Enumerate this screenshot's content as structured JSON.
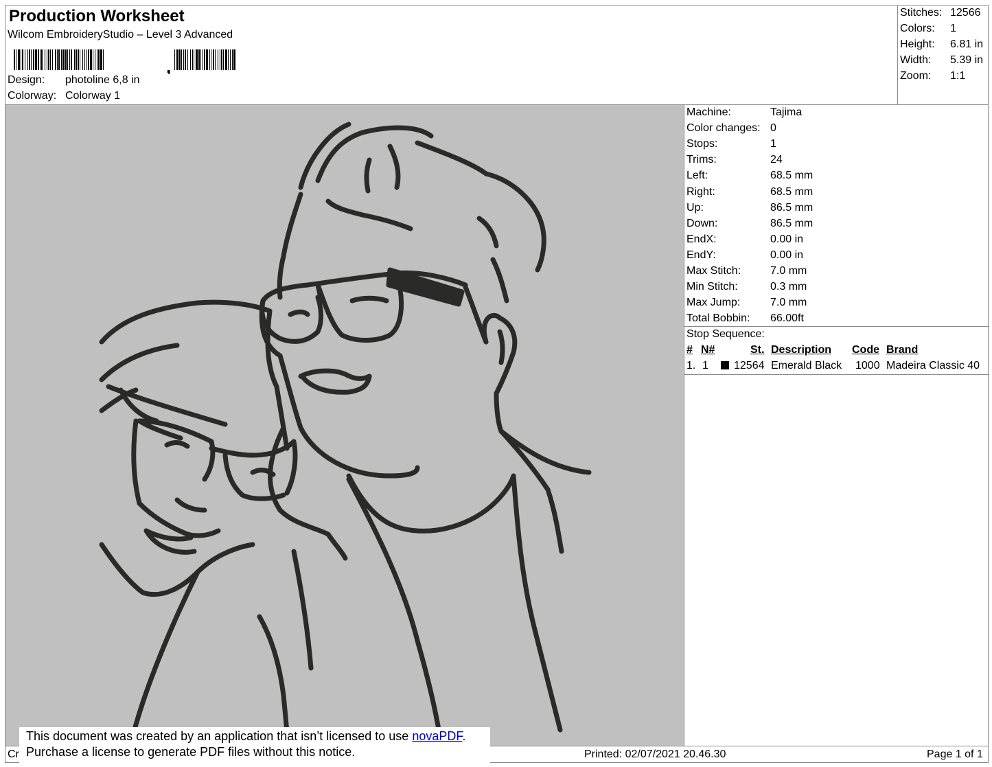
{
  "header": {
    "title": "Production Worksheet",
    "software": "Wilcom EmbroideryStudio – Level 3 Advanced",
    "design_label": "Design:",
    "design_value": "photoline 6,8 in",
    "colorway_label": "Colorway:",
    "colorway_value": "Colorway 1"
  },
  "stats": [
    {
      "label": "Stitches:",
      "value": "12566"
    },
    {
      "label": "Colors:",
      "value": "1"
    },
    {
      "label": "Height:",
      "value": "6.81 in"
    },
    {
      "label": "Width:",
      "value": "5.39 in"
    },
    {
      "label": "Zoom:",
      "value": "1:1"
    }
  ],
  "machine_details": [
    {
      "label": "Machine:",
      "value": "Tajima"
    },
    {
      "label": "Color changes:",
      "value": "0"
    },
    {
      "label": "Stops:",
      "value": "1"
    },
    {
      "label": "Trims:",
      "value": "24"
    },
    {
      "label": "Left:",
      "value": "68.5 mm"
    },
    {
      "label": "Right:",
      "value": "68.5 mm"
    },
    {
      "label": "Up:",
      "value": "86.5 mm"
    },
    {
      "label": "Down:",
      "value": "86.5 mm"
    },
    {
      "label": "EndX:",
      "value": "0.00 in"
    },
    {
      "label": "EndY:",
      "value": "0.00 in"
    },
    {
      "label": "Max Stitch:",
      "value": "7.0 mm"
    },
    {
      "label": "Min Stitch:",
      "value": "0.3 mm"
    },
    {
      "label": "Max Jump:",
      "value": "7.0 mm"
    },
    {
      "label": "Total Bobbin:",
      "value": "66.00ft"
    }
  ],
  "stop_sequence": {
    "title": "Stop Sequence:",
    "columns": [
      "#",
      "N#",
      "St.",
      "Description",
      "Code",
      "Brand"
    ],
    "rows": [
      {
        "index": "1.",
        "n": "1",
        "swatch_color": "#000000",
        "stitches": "12564",
        "description": "Emerald Black",
        "code": "1000",
        "brand": "Madeira Classic 40"
      }
    ]
  },
  "footer": {
    "left_text": "Cr",
    "printed": "Printed: 02/07/2021 20.46.30",
    "page": "Page 1 of 1"
  },
  "notice": {
    "line1_prefix": "This document was created by an application that isn’t licensed to use ",
    "link": "novaPDF",
    "line1_suffix": ".",
    "line2": "Purchase a license to generate PDF files without this notice."
  },
  "preview_background": "#c0c0c0",
  "thread_color": "#2a2a28"
}
